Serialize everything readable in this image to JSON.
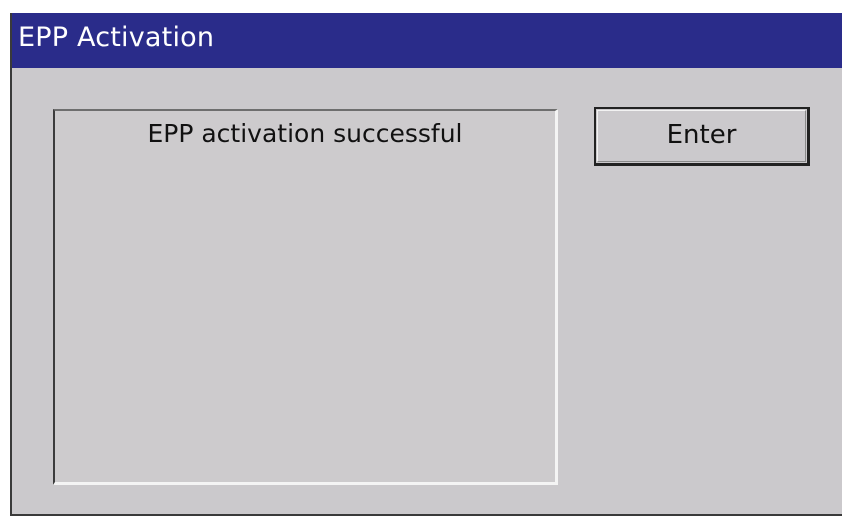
{
  "window": {
    "title": "EPP Activation"
  },
  "message": {
    "text": "EPP activation successful"
  },
  "buttons": {
    "enter_label": "Enter"
  },
  "colors": {
    "titlebar": "#2a2c8a",
    "background": "#cbc9cc",
    "title_text": "#ffffff"
  }
}
